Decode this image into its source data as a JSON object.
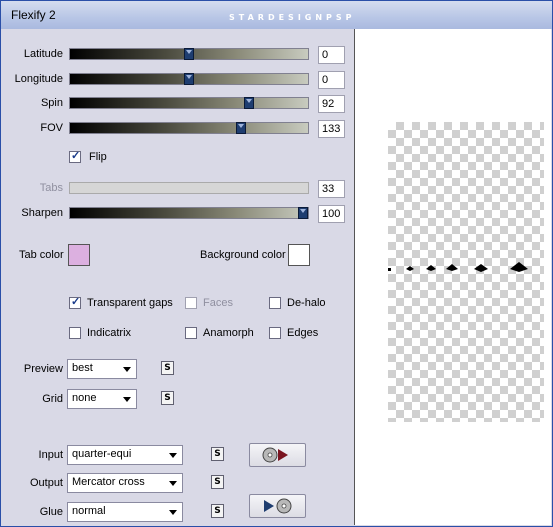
{
  "window": {
    "title": "Flexify 2",
    "brand": "STARDESIGNPSP"
  },
  "sliders": [
    {
      "label": "Latitude",
      "value": "0",
      "level": 0.5
    },
    {
      "label": "Longitude",
      "value": "0",
      "level": 0.5
    },
    {
      "label": "Spin",
      "value": "92",
      "level": 0.75
    },
    {
      "label": "FOV",
      "value": "133",
      "level": 0.72
    },
    {
      "label": "Tabs",
      "value": "33",
      "level": 0.0
    },
    {
      "label": "Sharpen",
      "value": "100",
      "level": 1.0
    }
  ],
  "flip": {
    "label": "Flip",
    "checked": true
  },
  "colors": {
    "tab_color_label": "Tab color",
    "tab_color": "#dcb0e0",
    "background_color_label": "Background color",
    "background_color": "#ffffff"
  },
  "options": {
    "transparent_gaps": "Transparent gaps",
    "faces": "Faces",
    "de_halo": "De-halo",
    "indicatrix": "Indicatrix",
    "anamorph": "Anamorph",
    "edges": "Edges"
  },
  "selects": {
    "preview_label": "Preview",
    "preview_value": "best",
    "grid_label": "Grid",
    "grid_value": "none",
    "input_label": "Input",
    "input_value": "quarter-equi",
    "output_label": "Output",
    "output_value": "Mercator cross",
    "glue_label": "Glue",
    "glue_value": "normal"
  },
  "small_button_label": "S"
}
